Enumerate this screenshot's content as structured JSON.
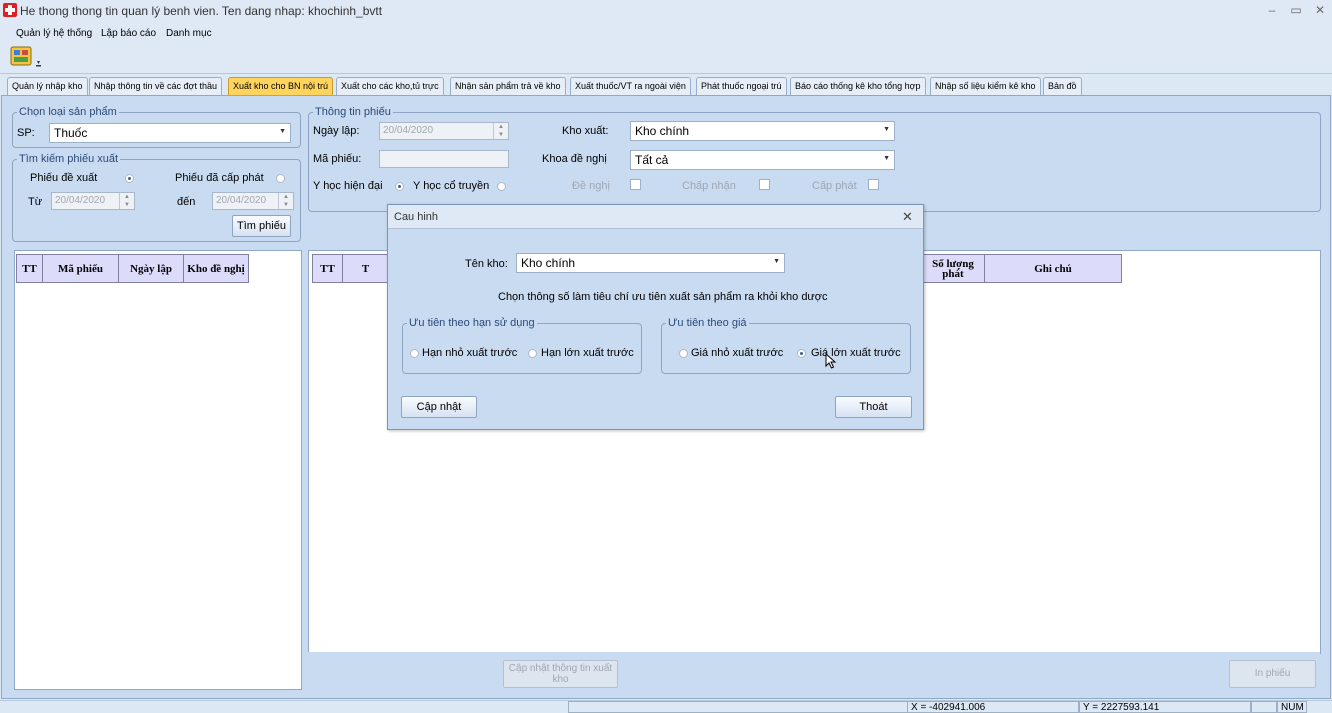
{
  "window": {
    "title": "He thong thong tin quan lý benh vien. Ten dang nhap: khochinh_bvtt"
  },
  "menu": {
    "items": [
      "Quản lý hệ thống",
      "Lập báo cáo",
      "Danh mục"
    ]
  },
  "tabs": [
    "Quản lý nhập kho",
    "Nhập thông tin về các đợt thầu",
    "Xuất kho cho BN nội trú",
    "Xuất cho các kho,tủ trực",
    "Nhận sản phẩm trả về kho",
    "Xuất thuốc/VT ra ngoài viện",
    "Phát thuốc ngoại trú",
    "Báo cáo thống kê kho tổng hợp",
    "Nhập số liệu kiểm kê kho",
    "Bản đồ"
  ],
  "active_tab_index": 2,
  "product_group": {
    "legend": "Chọn loại sản phẩm",
    "sp_label": "SP:",
    "sp_value": "Thuốc"
  },
  "search_group": {
    "legend": "Tìm kiếm phiếu xuất",
    "radio_proposed": "Phiếu đề xuất",
    "radio_issued": "Phiếu đã cấp phát",
    "from_label": "Từ",
    "from_value": "20/04/2020",
    "to_label": "đến",
    "to_value": "20/04/2020",
    "search_button": "Tìm phiếu"
  },
  "left_grid": {
    "columns": [
      "TT",
      "Mã phiếu",
      "Ngày lập",
      "Kho đề nghị"
    ]
  },
  "info_group": {
    "legend": "Thông tin phiếu",
    "date_label": "Ngày lập:",
    "date_value": "20/04/2020",
    "code_label": "Mã phiếu:",
    "code_value": "",
    "kho_xuat_label": "Kho xuất:",
    "kho_xuat_value": "Kho chính",
    "khoa_label": "Khoa đề nghị",
    "khoa_value": "Tất cả",
    "yhhd_label": "Y học hiện đại",
    "yhct_label": "Y học cổ truyền",
    "de_nghi_label": "Đề nghị",
    "chap_nhan_label": "Chấp nhận",
    "cap_phat_label": "Cấp phát"
  },
  "right_grid": {
    "columns": [
      "TT",
      "T",
      "Số lượng phát",
      "Ghi chú"
    ]
  },
  "bottom": {
    "update_button": "Cập nhật thông tin xuất kho",
    "print_button": "In phiếu"
  },
  "status": {
    "x": "X = -402941.006",
    "y": "Y = 2227593.141",
    "num": "NUM"
  },
  "dialog": {
    "title": "Cau hinh",
    "kho_label": "Tên kho:",
    "kho_value": "Kho chính",
    "instruction": "Chọn thông số làm tiêu chí ưu tiên xuất sản phẩm ra khỏi kho dược",
    "expiry_group": {
      "legend": "Ưu tiên theo hạn sử dụng",
      "option1": "Hạn nhỏ xuất trước",
      "option2": "Hạn lớn xuất trước"
    },
    "price_group": {
      "legend": "Ưu tiên theo giá",
      "option1": "Giá nhỏ xuất trước",
      "option2": "Giá lớn xuất trước",
      "selected": "option2"
    },
    "update_button": "Cập nhật",
    "exit_button": "Thoát"
  }
}
